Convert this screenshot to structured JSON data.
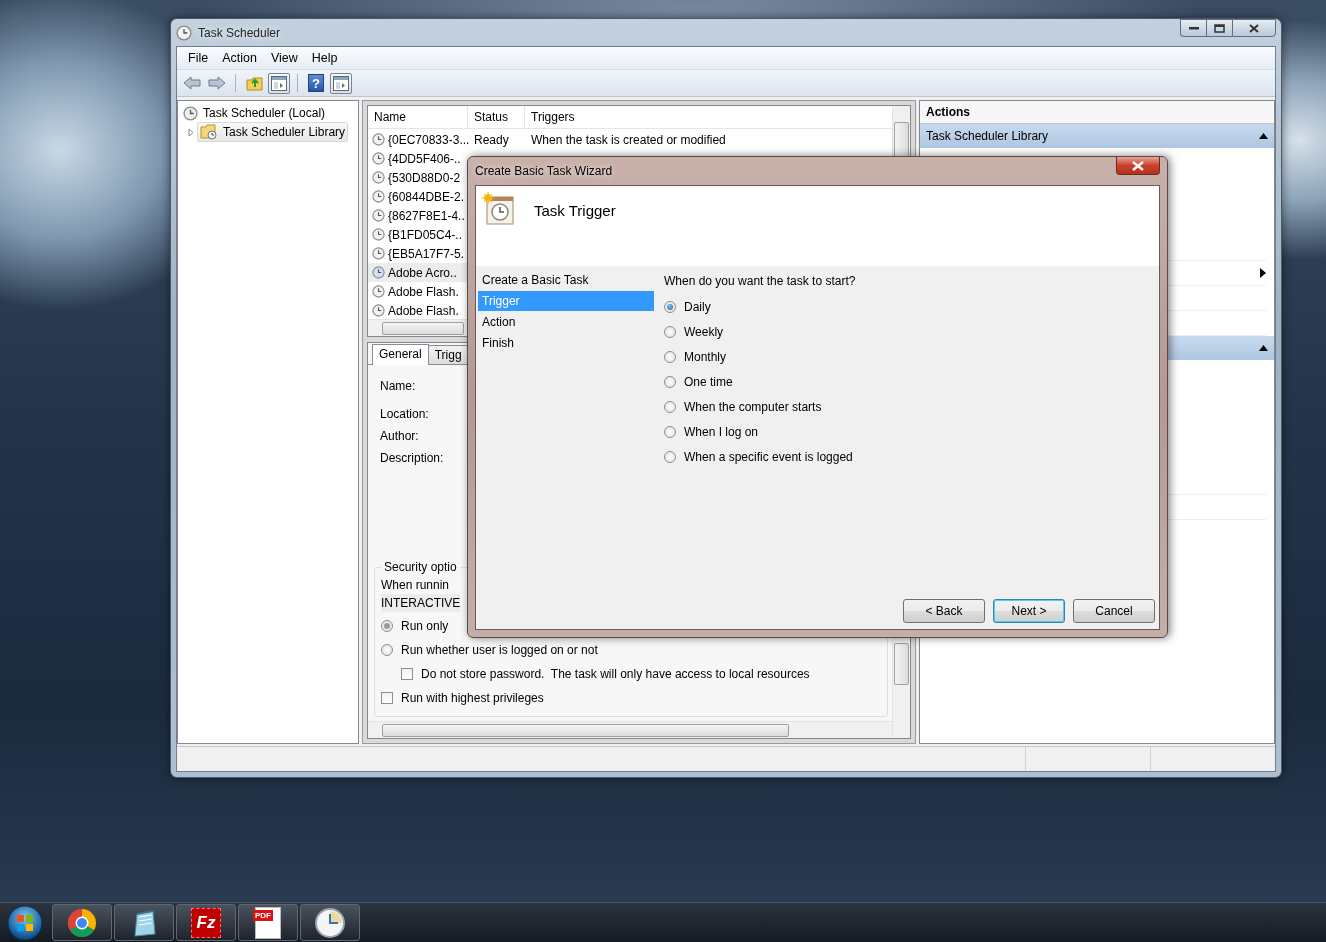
{
  "window": {
    "title": "Task Scheduler"
  },
  "menu": [
    "File",
    "Action",
    "View",
    "Help"
  ],
  "toolbar": [
    {
      "kind": "back",
      "pressed": false
    },
    {
      "kind": "forward",
      "pressed": false
    },
    {
      "kind": "separator"
    },
    {
      "kind": "folder-up",
      "pressed": false
    },
    {
      "kind": "pane",
      "pressed": true
    },
    {
      "kind": "separator"
    },
    {
      "kind": "help",
      "text": "?",
      "pressed": false
    },
    {
      "kind": "pane",
      "pressed": true
    }
  ],
  "tree": [
    {
      "label": "Task Scheduler (Local)",
      "selected": false,
      "children": [
        {
          "label": "Task Scheduler Library",
          "selected": true,
          "expanded": false
        }
      ]
    }
  ],
  "task_list": {
    "columns": [
      "Name",
      "Status",
      "Triggers"
    ],
    "rows": [
      {
        "name": "{0EC70833-3...",
        "status": "Ready",
        "triggers": "When the task is created or modified",
        "selected": false
      },
      {
        "name": "{4DD5F406-..",
        "selected": false
      },
      {
        "name": "{530D88D0-2",
        "selected": false
      },
      {
        "name": "{60844DBE-2.",
        "selected": false
      },
      {
        "name": "{8627F8E1-4..",
        "selected": false
      },
      {
        "name": "{B1FD05C4-..",
        "selected": false
      },
      {
        "name": "{EB5A17F7-5.",
        "selected": false
      },
      {
        "name": "Adobe Acro..",
        "selected": true
      },
      {
        "name": "Adobe Flash.",
        "selected": false
      },
      {
        "name": "Adobe Flash.",
        "selected": false
      }
    ]
  },
  "details": {
    "tabs": [
      {
        "label": "General",
        "selected": true
      },
      {
        "label": "Trigg",
        "selected": false
      }
    ],
    "fields": [
      "Name:",
      "Location:",
      "Author:",
      "Description:"
    ],
    "security": {
      "title": "Security optio",
      "user_label": "When runnin",
      "user_value": "INTERACTIVE",
      "options": [
        {
          "kind": "radio",
          "label": "Run only",
          "selected": true
        },
        {
          "kind": "radio",
          "label": "Run whether user is logged on or not",
          "selected": false
        },
        {
          "kind": "sub-checkbox",
          "label": "Do not store password.  The task will only have access to local resources",
          "checked": false
        },
        {
          "kind": "checkbox",
          "label": "Run with highest privileges",
          "checked": false
        }
      ]
    }
  },
  "actions": {
    "title": "Actions",
    "sections": [
      {
        "title": "Task Scheduler Library",
        "expanded": true
      },
      {
        "expanded": true
      }
    ]
  },
  "dialog": {
    "title": "Create Basic Task Wizard",
    "heading": "Task Trigger",
    "steps": [
      {
        "label": "Create a Basic Task",
        "selected": false
      },
      {
        "label": "Trigger",
        "selected": true
      },
      {
        "label": "Action",
        "selected": false
      },
      {
        "label": "Finish",
        "selected": false
      }
    ],
    "question": "When do you want the task to start?",
    "options": [
      {
        "label": "Daily",
        "selected": true
      },
      {
        "label": "Weekly",
        "selected": false
      },
      {
        "label": "Monthly",
        "selected": false
      },
      {
        "label": "One time",
        "selected": false
      },
      {
        "label": "When the computer starts",
        "selected": false
      },
      {
        "label": "When I log on",
        "selected": false
      },
      {
        "label": "When a specific event is logged",
        "selected": false
      }
    ],
    "buttons": [
      {
        "label": "< Back",
        "default": false
      },
      {
        "label": "Next >",
        "default": true
      },
      {
        "label": "Cancel",
        "default": false
      }
    ]
  },
  "taskbar": [
    {
      "kind": "start"
    },
    {
      "kind": "browser"
    },
    {
      "kind": "notepad"
    },
    {
      "kind": "ftp",
      "text": "Fz"
    },
    {
      "kind": "pdf",
      "text": "PDF"
    },
    {
      "kind": "clock"
    }
  ]
}
